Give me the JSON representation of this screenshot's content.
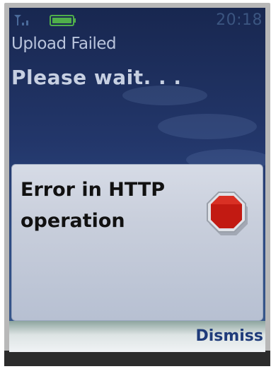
{
  "status_bar": {
    "time": "20:18",
    "signal_icon": "signal-strength-icon",
    "battery_icon": "battery-icon",
    "battery_color": "#4fae4a"
  },
  "header": {
    "title": "Upload Failed",
    "status_message": "Please wait. . ."
  },
  "dialog": {
    "message_line1": "Error in HTTP",
    "message_line2": "operation",
    "icon": "stop-sign-icon",
    "icon_color": "#c21a12"
  },
  "softkeys": {
    "right_label": "Dismiss"
  }
}
